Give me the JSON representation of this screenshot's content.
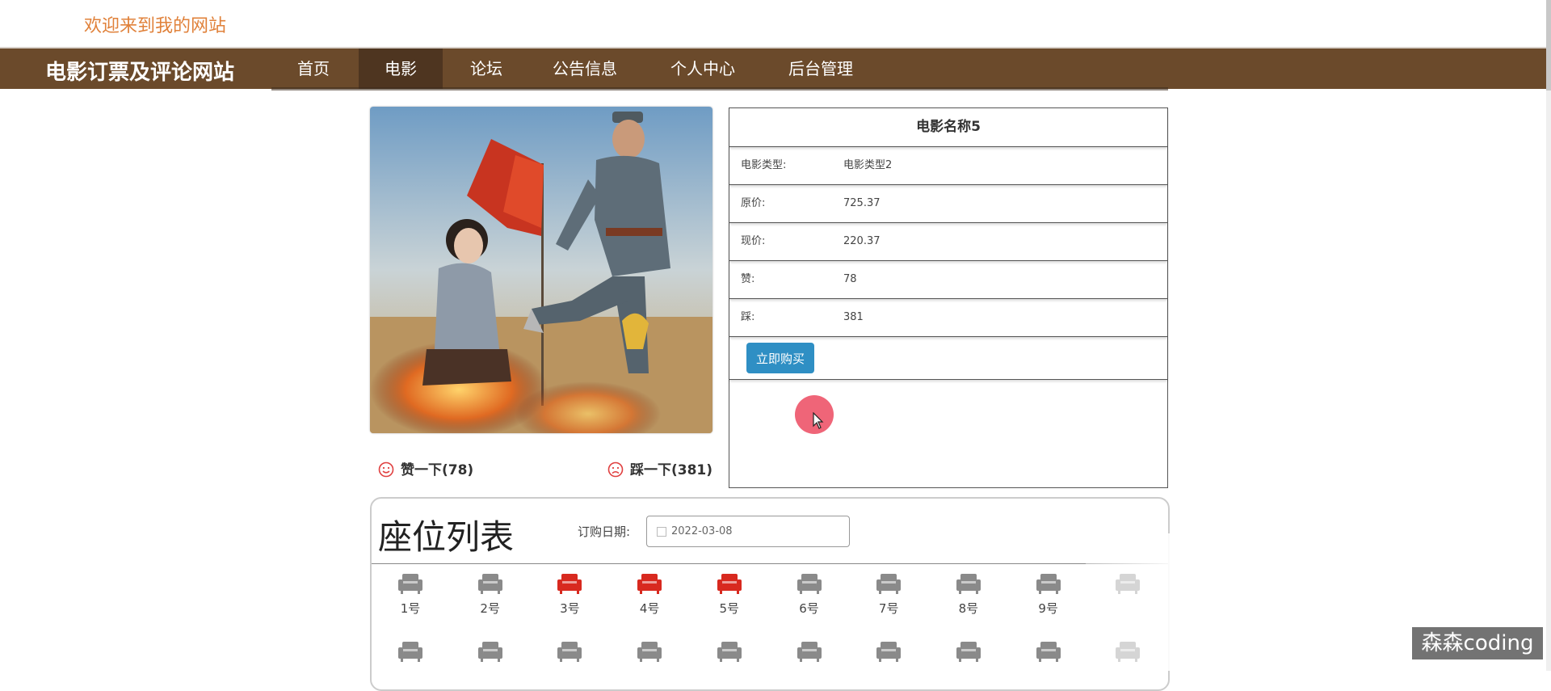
{
  "header": {
    "welcome": "欢迎来到我的网站"
  },
  "nav": {
    "brand": "电影订票及评论网站",
    "items": [
      {
        "label": "首页"
      },
      {
        "label": "电影"
      },
      {
        "label": "论坛"
      },
      {
        "label": "公告信息"
      },
      {
        "label": "个人中心"
      },
      {
        "label": "后台管理"
      }
    ],
    "active": "电影"
  },
  "movie": {
    "name": "电影名称5",
    "fields": [
      {
        "label": "电影类型:",
        "value": "电影类型2"
      },
      {
        "label": "原价:",
        "value": "725.37"
      },
      {
        "label": "现价:",
        "value": "220.37"
      },
      {
        "label": "赞:",
        "value": "78"
      },
      {
        "label": "踩:",
        "value": "381"
      }
    ],
    "buy_label": "立即购买",
    "like_label": "赞一下(78)",
    "dislike_label": "踩一下(381)"
  },
  "seats": {
    "title": "座位列表",
    "date_label": "订购日期:",
    "date_value": "2022-03-08",
    "row1": [
      {
        "num": "1号",
        "status": "available"
      },
      {
        "num": "2号",
        "status": "available"
      },
      {
        "num": "3号",
        "status": "taken"
      },
      {
        "num": "4号",
        "status": "taken"
      },
      {
        "num": "5号",
        "status": "taken"
      },
      {
        "num": "6号",
        "status": "available"
      },
      {
        "num": "7号",
        "status": "available"
      },
      {
        "num": "8号",
        "status": "available"
      },
      {
        "num": "9号",
        "status": "available"
      }
    ],
    "colors": {
      "available": "#8a8a8a",
      "taken": "#d8291f"
    }
  },
  "watermark": "森森coding"
}
